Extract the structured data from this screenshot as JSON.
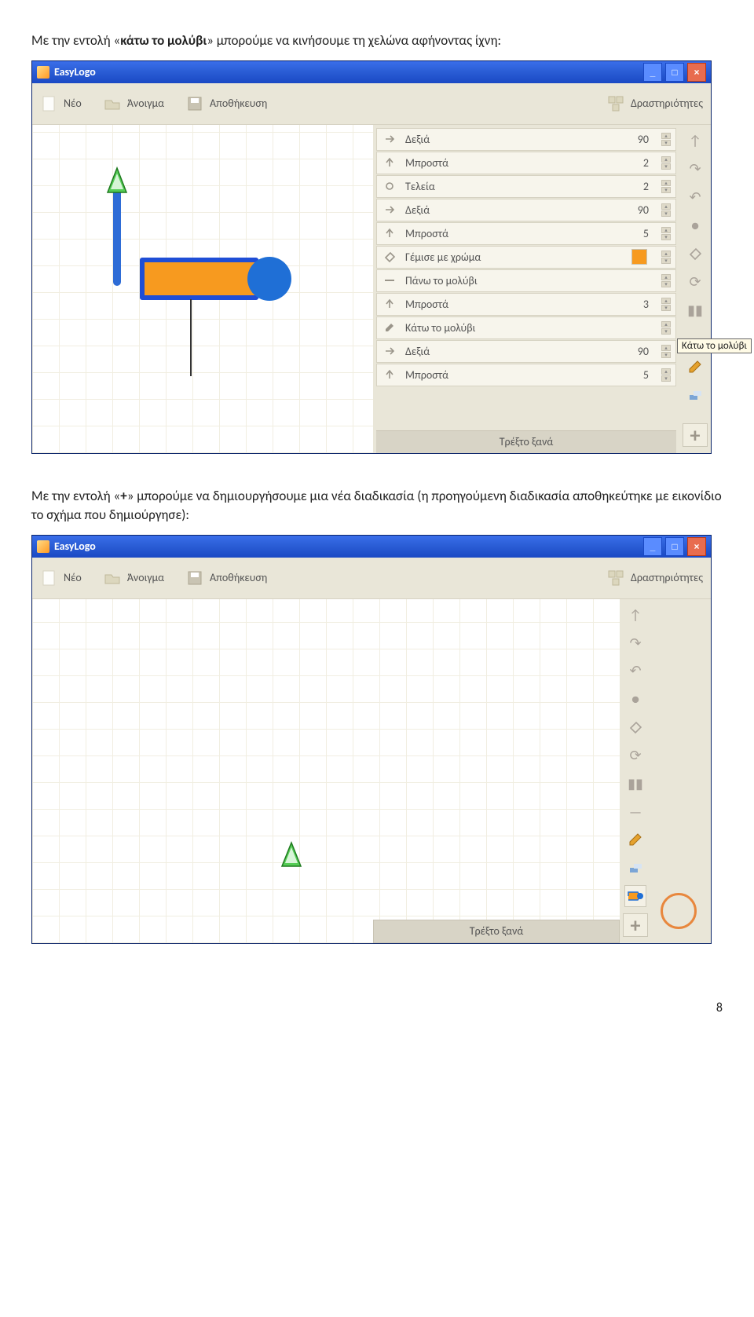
{
  "para1_a": "Με την εντολή «",
  "para1_b": "κάτω το μολύβι",
  "para1_c": "» μπορούμε να κινήσουμε τη χελώνα αφήνοντας ίχνη:",
  "para2_a": "Με την εντολή «",
  "para2_b": "+",
  "para2_c": "» μπορούμε να δημιουργήσουμε μια νέα διαδικασία (η προηγούμενη διαδικασία αποθηκεύτηκε με εικονίδιο το σχήμα που δημιούργησε):",
  "page_number": "8",
  "window": {
    "title": "EasyLogo",
    "toolbar": {
      "new": "Νέο",
      "open": "Άνοιγμα",
      "save": "Αποθήκευση",
      "activities": "Δραστηριότητες"
    },
    "run_again": "Τρέξτο ξανά"
  },
  "commands": [
    {
      "icon": "arrow-right",
      "label": "Δεξιά",
      "value": "90"
    },
    {
      "icon": "arrow-up",
      "label": "Μπροστά",
      "value": "2"
    },
    {
      "icon": "dot",
      "label": "Τελεία",
      "value": "2"
    },
    {
      "icon": "arrow-right",
      "label": "Δεξιά",
      "value": "90"
    },
    {
      "icon": "arrow-up",
      "label": "Μπροστά",
      "value": "5"
    },
    {
      "icon": "bucket",
      "label": "Γέμισε με χρώμα",
      "value": "",
      "swatch": "#f79a1f"
    },
    {
      "icon": "pen-up",
      "label": "Πάνω το μολύβι",
      "value": ""
    },
    {
      "icon": "arrow-up",
      "label": "Μπροστά",
      "value": "3"
    },
    {
      "icon": "pen-down",
      "label": "Κάτω το μολύβι",
      "value": ""
    },
    {
      "icon": "arrow-right",
      "label": "Δεξιά",
      "value": "90"
    },
    {
      "icon": "arrow-up",
      "label": "Μπροστά",
      "value": "5"
    }
  ],
  "tooltip_pendown": "Κάτω το μολύβι"
}
